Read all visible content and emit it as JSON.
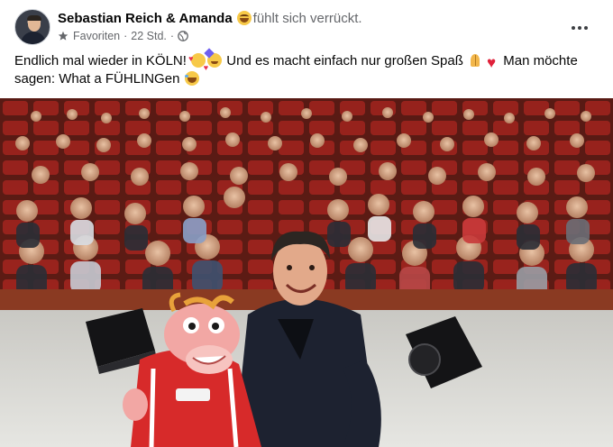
{
  "post": {
    "author": "Sebastian Reich & Amanda",
    "feeling": "fühlt sich verrückt.",
    "feeling_emoji": "grinning-face-icon",
    "audience": "Favoriten",
    "time": "22 Std.",
    "separator": "·",
    "privacy_icon": "globe-icon",
    "more_icon": "more-dots-icon",
    "text": {
      "part1": "Endlich mal wieder in KÖLN!",
      "part2": "Und es macht einfach nur großen Spaß",
      "part3": "Man möchte sagen: What a FÜHLINGen"
    },
    "text_emojis": [
      "smiling-face-with-hearts-icon",
      "partying-face-icon",
      "folded-hands-icon",
      "red-heart-icon",
      "rolling-laughing-icon"
    ]
  },
  "photo": {
    "subject": "photo-stage-selfie",
    "colors": {
      "seats": "#a3231e",
      "wall": "#6e2a1a",
      "stage": "#d9d9d4",
      "puppet_shirt": "#d72a2a",
      "puppet_skin": "#f2a7a4",
      "jacket": "#1d2230"
    }
  }
}
